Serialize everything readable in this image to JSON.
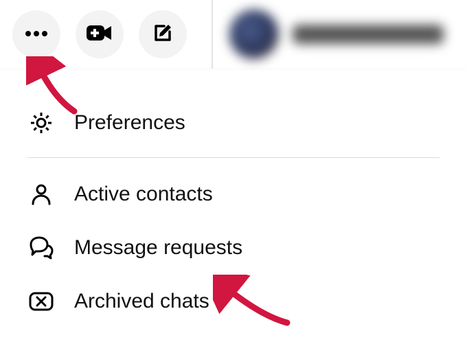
{
  "menu": {
    "preferences": "Preferences",
    "active_contacts": "Active contacts",
    "message_requests": "Message requests",
    "archived_chats": "Archived chats"
  }
}
